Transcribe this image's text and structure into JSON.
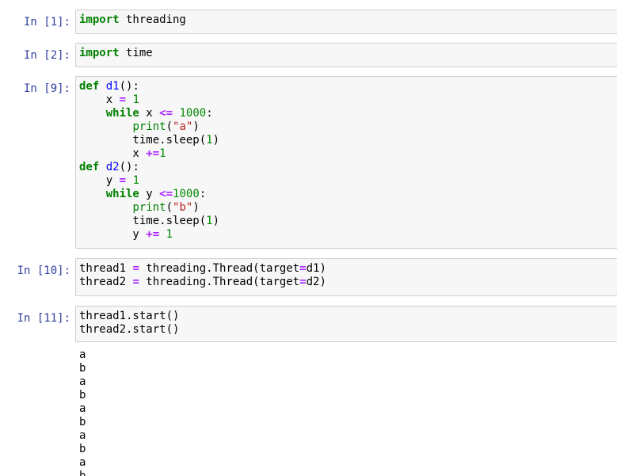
{
  "cells": [
    {
      "prompt": "In [1]:"
    },
    {
      "prompt": "In [2]:"
    },
    {
      "prompt": "In [9]:"
    },
    {
      "prompt": "In [10]:"
    },
    {
      "prompt": "In [11]:"
    }
  ],
  "code": {
    "c1": {
      "kw_import": "import",
      "mod": " threading"
    },
    "c2": {
      "kw_import": "import",
      "mod": " time"
    },
    "c3": {
      "l1_def": "def",
      "l1_name": "d1",
      "l1_rest": "():",
      "l2_var": "    x ",
      "l2_op": "=",
      "l2_num": "1",
      "l3_kw": "while",
      "l3_var": " x ",
      "l3_op": "<=",
      "l3_num": "1000",
      "l3_end": ":",
      "l4_bi": "print",
      "l4_str": "\"a\"",
      "l5_a": "time.sleep(",
      "l5_num": "1",
      "l5_b": ")",
      "l6_var": "        x ",
      "l6_op": "+=",
      "l6_num": "1",
      "l7_def": "def",
      "l7_name": "d2",
      "l7_rest": "():",
      "l8_var": "    y ",
      "l8_op": "=",
      "l8_num": "1",
      "l9_kw": "while",
      "l9_var": " y ",
      "l9_op": "<=",
      "l9_num": "1000",
      "l9_end": ":",
      "l10_bi": "print",
      "l10_str": "\"b\"",
      "l11_a": "time.sleep(",
      "l11_num": "1",
      "l11_b": ")",
      "l12_var": "        y ",
      "l12_op": "+=",
      "l12_num": "1"
    },
    "c4": {
      "l1_a": "thread1 ",
      "l1_op": "=",
      "l1_b": " threading.Thread(target",
      "l1_op2": "=",
      "l1_c": "d1)",
      "l2_a": "thread2 ",
      "l2_op": "=",
      "l2_b": " threading.Thread(target",
      "l2_op2": "=",
      "l2_c": "d2)"
    },
    "c5": {
      "l1": "thread1.start()",
      "l2": "thread2.start()"
    }
  },
  "output": [
    "a",
    "b",
    "a",
    "b",
    "a",
    "b",
    "a",
    "b",
    "a",
    "b"
  ],
  "colors": {
    "prompt": "#303f9f",
    "keyword": "#008000",
    "operator": "#aa22ff",
    "number": "#008800",
    "string": "#ba2121",
    "function_name": "#0000ff",
    "cell_background": "#f7f7f7",
    "cell_border": "#cfcfcf"
  }
}
